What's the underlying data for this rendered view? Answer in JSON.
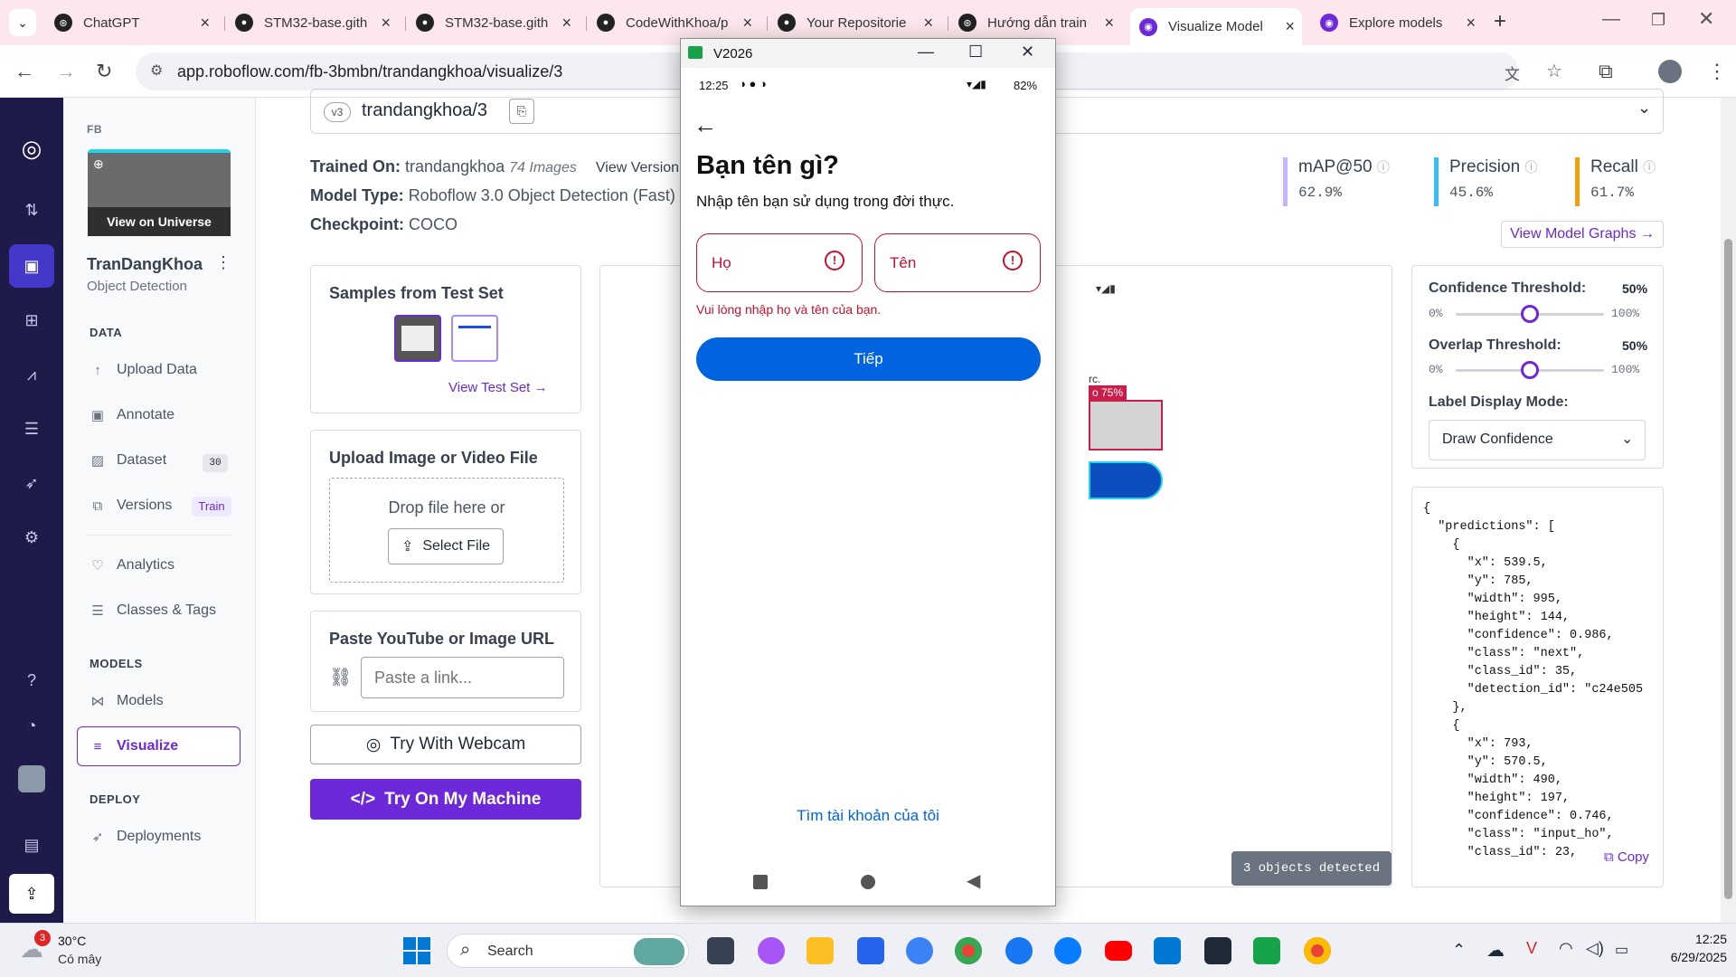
{
  "browser": {
    "tabs": [
      {
        "title": "ChatGPT",
        "icon": "chatgpt-icon"
      },
      {
        "title": "STM32-base.gith",
        "icon": "github-icon"
      },
      {
        "title": "STM32-base.gith",
        "icon": "github-icon"
      },
      {
        "title": "CodeWithKhoa/p",
        "icon": "github-icon"
      },
      {
        "title": "Your Repositorie",
        "icon": "github-icon"
      },
      {
        "title": "Hướng dẫn train",
        "icon": "chatgpt-icon"
      },
      {
        "title": "Visualize Model",
        "icon": "roboflow-icon"
      },
      {
        "title": "Explore models",
        "icon": "roboflow-icon"
      }
    ],
    "url": "app.roboflow.com/fb-3bmbn/trandangkhoa/visualize/3"
  },
  "sidebar": {
    "workspace": "FB",
    "universe_label": "View on Universe",
    "project_name": "TranDangKhoa",
    "project_type": "Object Detection",
    "data_heading": "DATA",
    "items": [
      {
        "label": "Upload Data",
        "icon": "upload-arrow-icon"
      },
      {
        "label": "Annotate",
        "icon": "annotate-icon"
      },
      {
        "label": "Dataset",
        "icon": "dataset-icon",
        "badge": "30"
      },
      {
        "label": "Versions",
        "icon": "versions-icon",
        "badge": "Train"
      },
      {
        "label": "Analytics",
        "icon": "analytics-icon"
      },
      {
        "label": "Classes & Tags",
        "icon": "classes-icon"
      }
    ],
    "models_heading": "MODELS",
    "models_items": [
      {
        "label": "Models",
        "icon": "models-icon"
      },
      {
        "label": "Visualize",
        "icon": "visualize-icon"
      }
    ],
    "deploy_heading": "DEPLOY",
    "deploy_items": [
      {
        "label": "Deployments",
        "icon": "rocket-icon"
      }
    ]
  },
  "model": {
    "version_badge": "v3",
    "version_name": "trandangkhoa/3",
    "trained_on_label": "Trained On:",
    "trained_on_value": "trandangkhoa",
    "images_count": "74 Images",
    "view_version": "View Version",
    "type_label": "Model Type:",
    "type_value": "Roboflow 3.0 Object Detection (Fast)",
    "checkpoint_label": "Checkpoint:",
    "checkpoint_value": "COCO",
    "metrics": [
      {
        "name": "mAP@50",
        "value": "62.9%",
        "color": "#c4b5fd"
      },
      {
        "name": "Precision",
        "value": "45.6%",
        "color": "#38bdf8"
      },
      {
        "name": "Recall",
        "value": "61.7%",
        "color": "#f59e0b"
      }
    ],
    "view_graphs": "View Model Graphs →"
  },
  "samples": {
    "title": "Samples from Test Set",
    "view_link": "View Test Set →"
  },
  "upload": {
    "title": "Upload Image or Video File",
    "drop_text": "Drop file here or",
    "select_btn": "Select File"
  },
  "paste": {
    "title": "Paste YouTube or Image URL",
    "placeholder": "Paste a link..."
  },
  "webcam_btn": "Try With Webcam",
  "machine_btn": "Try On My Machine",
  "canvas": {
    "label_snippet": "rc.",
    "label_conf": "o 75%",
    "objects_detected": "3 objects detected"
  },
  "settings": {
    "confidence_label": "Confidence Threshold:",
    "confidence_value": "50%",
    "confidence_level": 0.5,
    "overlap_label": "Overlap Threshold:",
    "overlap_value": "50%",
    "overlap_level": 0.5,
    "min": "0%",
    "max": "100%",
    "display_mode_label": "Label Display Mode:",
    "display_mode_value": "Draw Confidence"
  },
  "json_output": {
    "lines": [
      "{",
      "  \"predictions\": [",
      "    {",
      "      \"x\": 539.5,",
      "      \"y\": 785,",
      "      \"width\": 995,",
      "      \"height\": 144,",
      "      \"confidence\": 0.986,",
      "      \"class\": \"next\",",
      "      \"class_id\": 35,",
      "      \"detection_id\": \"c24e505",
      "    },",
      "    {",
      "      \"x\": 793,",
      "      \"y\": 570.5,",
      "      \"width\": 490,",
      "      \"height\": 197,",
      "      \"confidence\": 0.746,",
      "      \"class\": \"input_ho\",",
      "      \"class_id\": 23,"
    ],
    "copy_label": "Copy"
  },
  "phone": {
    "window_title": "V2026",
    "status_time": "12:25",
    "battery": "82%",
    "heading": "Bạn tên gì?",
    "subtitle": "Nhập tên bạn sử dụng trong đời thực.",
    "first_field": "Họ",
    "last_field": "Tên",
    "error": "Vui lòng nhập họ và tên của bạn.",
    "next_btn": "Tiếp",
    "find_account": "Tìm tài khoản của tôi",
    "accent": "#0064e0",
    "error_color": "#c8102e"
  },
  "taskbar": {
    "weather_temp": "30°C",
    "weather_desc": "Có mây",
    "weather_badge": "3",
    "search_label": "Search",
    "time": "12:25",
    "date": "6/29/2025"
  }
}
